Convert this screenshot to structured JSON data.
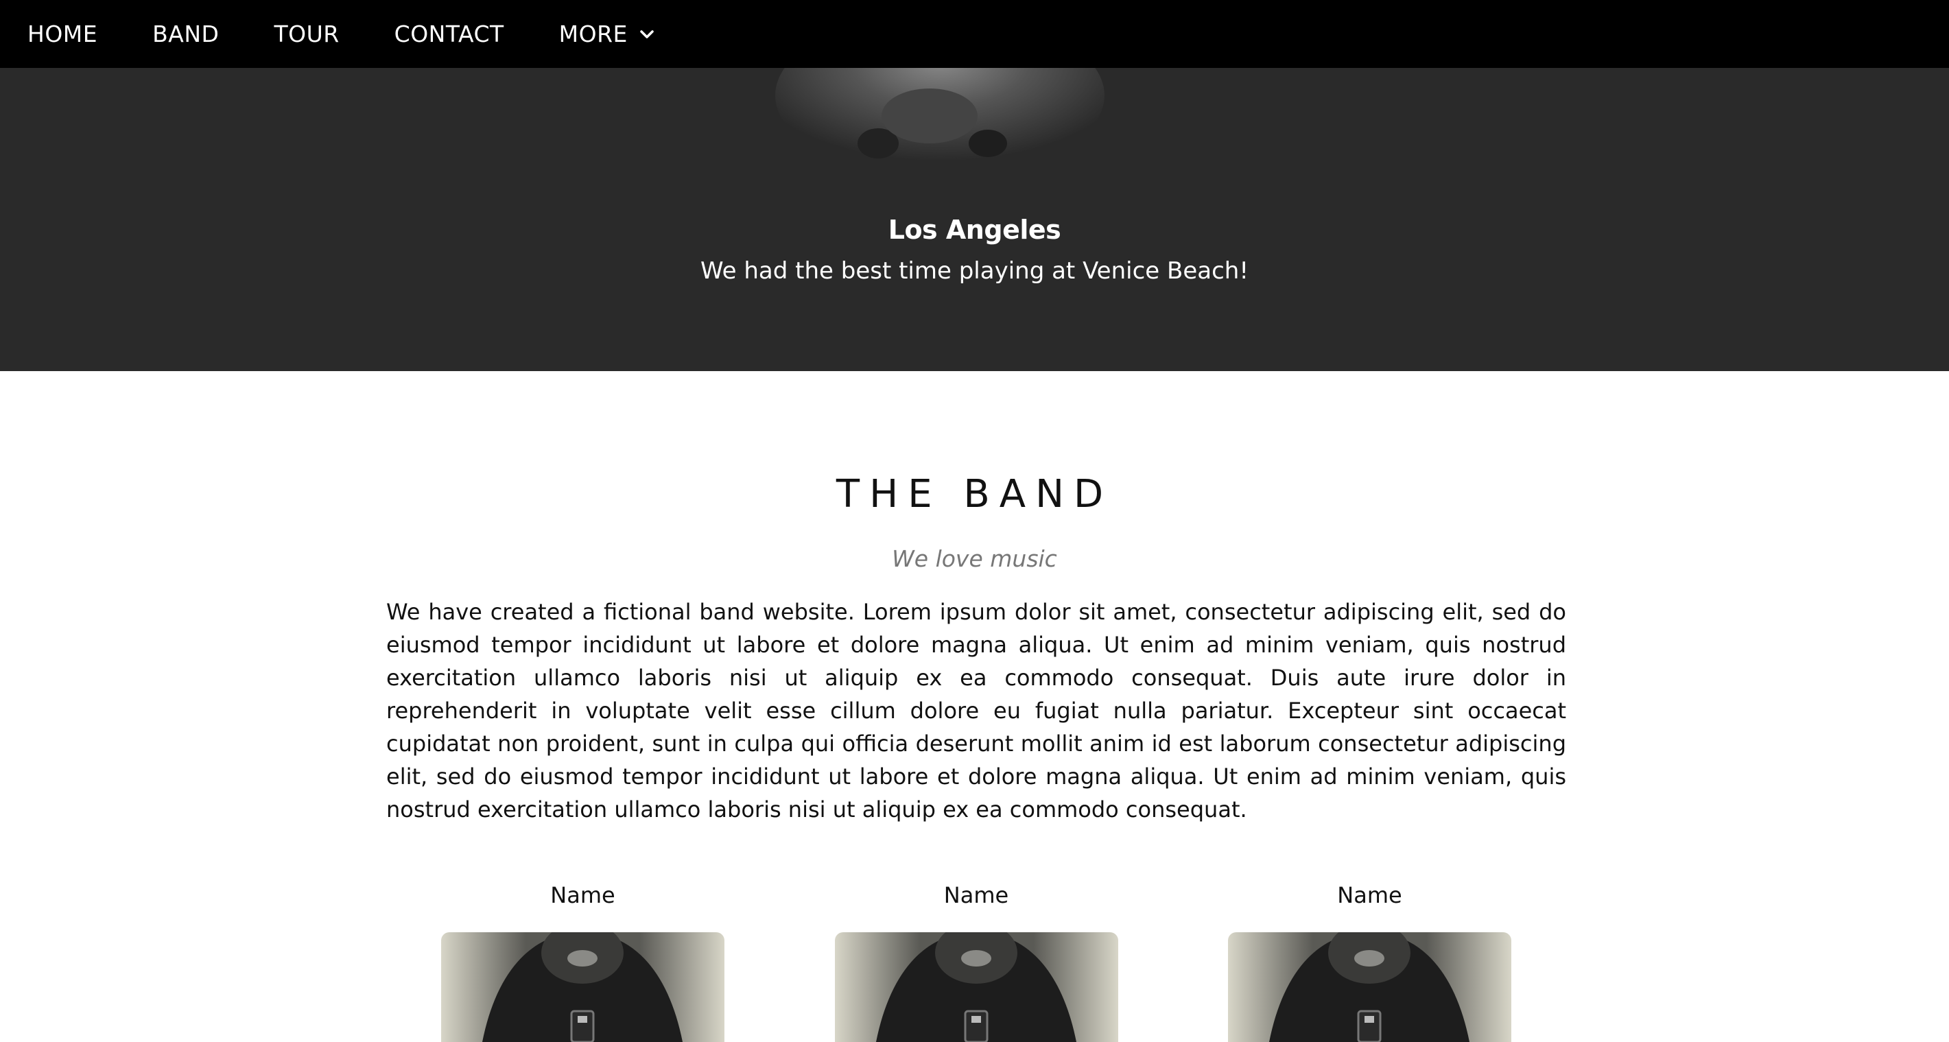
{
  "nav": {
    "items": [
      {
        "label": "HOME"
      },
      {
        "label": "BAND"
      },
      {
        "label": "TOUR"
      },
      {
        "label": "CONTACT"
      },
      {
        "label": "MORE"
      }
    ]
  },
  "hero": {
    "title": "Los Angeles",
    "subtitle": "We had the best time playing at Venice Beach!"
  },
  "band": {
    "title": "THE BAND",
    "tagline": "We love music",
    "description": "We have created a fictional band website. Lorem ipsum dolor sit amet, consectetur adipiscing elit, sed do eiusmod tempor incididunt ut labore et dolore magna aliqua. Ut enim ad minim veniam, quis nostrud exercitation ullamco laboris nisi ut aliquip ex ea commodo consequat. Duis aute irure dolor in reprehenderit in voluptate velit esse cillum dolore eu fugiat nulla pariatur. Excepteur sint occaecat cupidatat non proident, sunt in culpa qui officia deserunt mollit anim id est laborum consectetur adipiscing elit, sed do eiusmod tempor incididunt ut labore et dolore magna aliqua. Ut enim ad minim veniam, quis nostrud exercitation ullamco laboris nisi ut aliquip ex ea commodo consequat.",
    "members": [
      {
        "name": "Name"
      },
      {
        "name": "Name"
      },
      {
        "name": "Name"
      }
    ]
  },
  "colors": {
    "nav_bg": "#000000",
    "hero_bg": "#2a2a2a",
    "tagline": "#777777"
  }
}
